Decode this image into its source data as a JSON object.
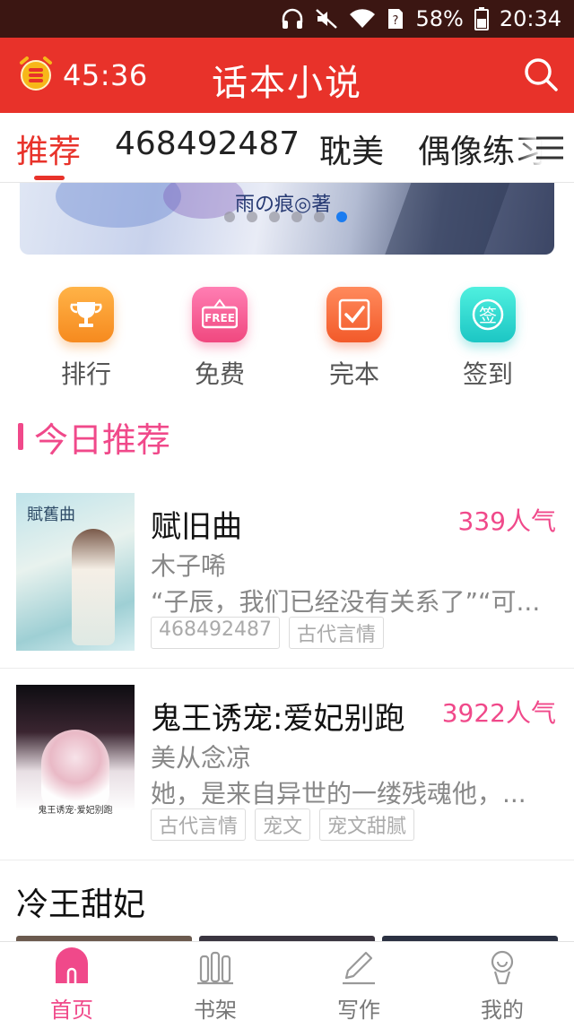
{
  "status_bar": {
    "battery": "58%",
    "time": "20:34"
  },
  "header": {
    "timer": "45:36",
    "title": "话本小说"
  },
  "tabs": [
    {
      "label": "推荐",
      "active": true
    },
    {
      "label": "468492487"
    },
    {
      "label": "耽美"
    },
    {
      "label": "偶像练习"
    }
  ],
  "banner": {
    "caption": "雨の痕◎著",
    "dots": 6,
    "active_dot": 6
  },
  "quick_links": [
    {
      "label": "排行",
      "icon": "trophy-icon"
    },
    {
      "label": "免费",
      "icon": "free-sign-icon",
      "icon_text": "FREE"
    },
    {
      "label": "完本",
      "icon": "check-book-icon"
    },
    {
      "label": "签到",
      "icon": "sign-in-icon",
      "icon_text": "签"
    }
  ],
  "section": {
    "title": "今日推荐"
  },
  "books": [
    {
      "title": "赋旧曲",
      "popularity": "339人气",
      "author": "木子唏",
      "desc": "“子辰，我们已经没有关系了”“可...",
      "tags": [
        "468492487",
        "古代言情"
      ],
      "cover_text": "賦舊曲"
    },
    {
      "title": "鬼王诱宠:爱妃别跑",
      "popularity": "3922人气",
      "author": "美从念凉",
      "desc": "她，是来自异世的一缕残魂他，...",
      "tags": [
        "古代言情",
        "宠文",
        "宠文甜腻"
      ],
      "cover_text": "鬼王诱宠·爱妃别跑"
    }
  ],
  "next_section": {
    "title": "冷王甜妃"
  },
  "bottom_nav": [
    {
      "label": "首页",
      "icon": "home-icon",
      "active": true
    },
    {
      "label": "书架",
      "icon": "bookshelf-icon"
    },
    {
      "label": "写作",
      "icon": "pen-icon"
    },
    {
      "label": "我的",
      "icon": "profile-icon"
    }
  ],
  "colors": {
    "header_red": "#e8322a",
    "accent_pink": "#f0498a",
    "status_bar": "#3b1612"
  }
}
